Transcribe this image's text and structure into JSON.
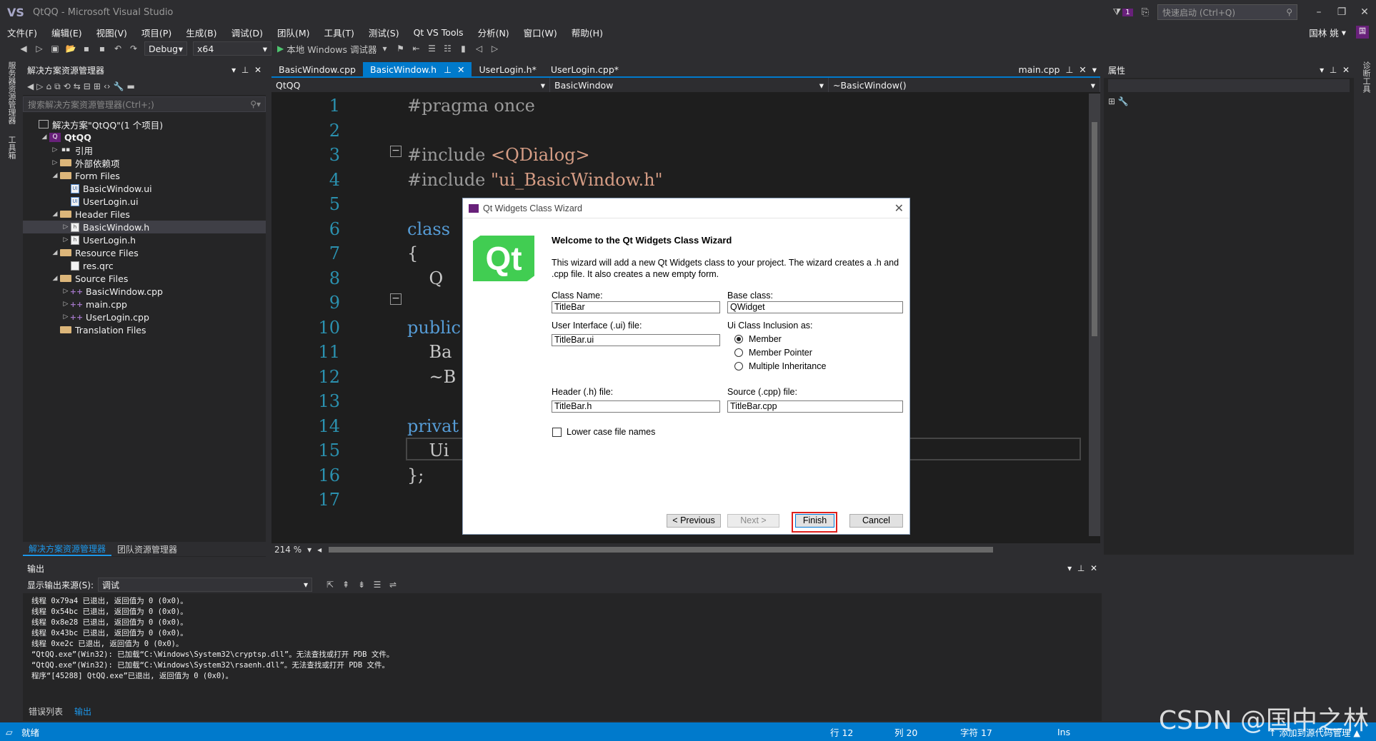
{
  "window": {
    "title": "QtQQ - Microsoft Visual Studio",
    "logo": "VS",
    "notif_count": "1",
    "quick_launch": "快速启动 (Ctrl+Q)",
    "user": "国林 姚",
    "user_badge": "国"
  },
  "menu": [
    "文件(F)",
    "编辑(E)",
    "视图(V)",
    "项目(P)",
    "生成(B)",
    "调试(D)",
    "团队(M)",
    "工具(T)",
    "测试(S)",
    "Qt VS Tools",
    "分析(N)",
    "窗口(W)",
    "帮助(H)"
  ],
  "toolbar": {
    "config": "Debug",
    "platform": "x64",
    "run_label": "本地 Windows 调试器"
  },
  "side_tabs": {
    "left1": "服务器资源管理器",
    "left2": "工具箱",
    "right1": "诊断工具"
  },
  "solution": {
    "title": "解决方案资源管理器",
    "search_placeholder": "搜索解决方案资源管理器(Ctrl+;)",
    "tree": [
      {
        "label": "解决方案\"QtQQ\"(1 个项目)",
        "depth": 0,
        "icon": "solution-icon",
        "tw": ""
      },
      {
        "label": "QtQQ",
        "depth": 1,
        "icon": "project-icon",
        "tw": "◢",
        "bold": true
      },
      {
        "label": "引用",
        "depth": 2,
        "icon": "references-icon",
        "tw": "▷"
      },
      {
        "label": "外部依赖项",
        "depth": 2,
        "icon": "folder-icon",
        "tw": "▷"
      },
      {
        "label": "Form Files",
        "depth": 2,
        "icon": "folder-icon",
        "tw": "◢"
      },
      {
        "label": "BasicWindow.ui",
        "depth": 3,
        "icon": "ui-file-icon",
        "tw": ""
      },
      {
        "label": "UserLogin.ui",
        "depth": 3,
        "icon": "ui-file-icon",
        "tw": ""
      },
      {
        "label": "Header Files",
        "depth": 2,
        "icon": "folder-icon",
        "tw": "◢"
      },
      {
        "label": "BasicWindow.h",
        "depth": 3,
        "icon": "header-file-icon",
        "tw": "▷",
        "selected": true
      },
      {
        "label": "UserLogin.h",
        "depth": 3,
        "icon": "header-file-icon",
        "tw": "▷"
      },
      {
        "label": "Resource Files",
        "depth": 2,
        "icon": "folder-icon",
        "tw": "◢"
      },
      {
        "label": "res.qrc",
        "depth": 3,
        "icon": "qrc-file-icon",
        "tw": ""
      },
      {
        "label": "Source Files",
        "depth": 2,
        "icon": "folder-icon",
        "tw": "◢"
      },
      {
        "label": "BasicWindow.cpp",
        "depth": 3,
        "icon": "cpp-file-icon",
        "tw": "▷"
      },
      {
        "label": "main.cpp",
        "depth": 3,
        "icon": "cpp-file-icon",
        "tw": "▷"
      },
      {
        "label": "UserLogin.cpp",
        "depth": 3,
        "icon": "cpp-file-icon",
        "tw": "▷"
      },
      {
        "label": "Translation Files",
        "depth": 2,
        "icon": "folder-icon",
        "tw": ""
      }
    ],
    "footer_tabs": [
      "解决方案资源管理器",
      "团队资源管理器"
    ]
  },
  "doc_tabs": [
    {
      "label": "BasicWindow.cpp",
      "active": false
    },
    {
      "label": "BasicWindow.h",
      "active": true
    },
    {
      "label": "UserLogin.h*",
      "active": false
    },
    {
      "label": "UserLogin.cpp*",
      "active": false
    }
  ],
  "doc_tab_far": "main.cpp",
  "editor": {
    "nav": {
      "project": "QtQQ",
      "class": "BasicWindow",
      "member": "~BasicWindow()"
    },
    "line_numbers": [
      "1",
      "2",
      "3",
      "4",
      "5",
      "6",
      "7",
      "8",
      "9",
      "10",
      "11",
      "12",
      "13",
      "14",
      "15",
      "16",
      "17"
    ],
    "zoom": "214 %"
  },
  "props": {
    "title": "属性"
  },
  "output": {
    "title": "输出",
    "source_label": "显示输出来源(S):",
    "source_value": "调试",
    "lines": [
      "线程 0x79a4 已退出, 返回值为 0 (0x0)。",
      "线程 0x54bc 已退出, 返回值为 0 (0x0)。",
      "线程 0x8e28 已退出, 返回值为 0 (0x0)。",
      "线程 0x43bc 已退出, 返回值为 0 (0x0)。",
      "线程 0xe2c 已退出, 返回值为 0 (0x0)。",
      "“QtQQ.exe”(Win32): 已加载“C:\\Windows\\System32\\cryptsp.dll”。无法查找或打开 PDB 文件。",
      "“QtQQ.exe”(Win32): 已加载“C:\\Windows\\System32\\rsaenh.dll”。无法查找或打开 PDB 文件。",
      "程序“[45288] QtQQ.exe”已退出, 返回值为 0 (0x0)。"
    ],
    "footer_tabs": [
      "错误列表",
      "输出"
    ]
  },
  "status": {
    "ready": "就绪",
    "line": "行 12",
    "col": "列 20",
    "char": "字符 17",
    "mode": "Ins",
    "source_control": "↑ 添加到源代码管理 ▲"
  },
  "watermark": "CSDN @国中之林",
  "dialog": {
    "title": "Qt Widgets Class Wizard",
    "logo": "Qt",
    "heading": "Welcome to the Qt Widgets Class Wizard",
    "description": "This wizard will add a new Qt Widgets class to your project. The wizard creates a .h and .cpp file. It also creates a new empty form.",
    "class_name_label": "Class Name:",
    "class_name": "TitleBar",
    "base_class_label": "Base class:",
    "base_class": "QWidget",
    "ui_file_label": "User Interface (.ui) file:",
    "ui_file": "TitleBar.ui",
    "inclusion_label": "Ui Class Inclusion as:",
    "inclusion_options": [
      "Member",
      "Member Pointer",
      "Multiple Inheritance"
    ],
    "inclusion_selected": "Member",
    "header_label": "Header (.h) file:",
    "header_file": "TitleBar.h",
    "source_label": "Source (.cpp) file:",
    "source_file": "TitleBar.cpp",
    "lowercase_label": "Lower case file names",
    "lowercase_checked": false,
    "buttons": {
      "previous": "< Previous",
      "next": "Next >",
      "finish": "Finish",
      "cancel": "Cancel"
    }
  }
}
